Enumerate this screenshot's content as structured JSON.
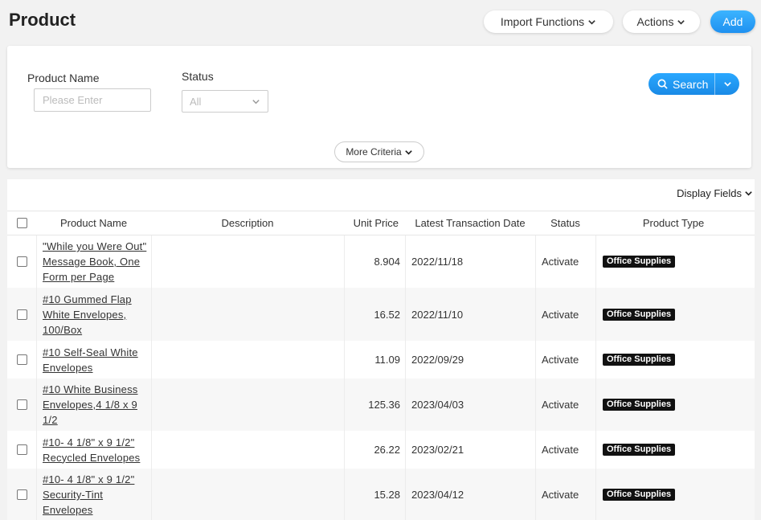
{
  "header": {
    "title": "Product",
    "import_label": "Import Functions",
    "actions_label": "Actions",
    "add_label": "Add"
  },
  "filters": {
    "product_name_label": "Product Name",
    "product_name_placeholder": "Please Enter",
    "status_label": "Status",
    "status_value": "All",
    "search_label": "Search",
    "more_criteria_label": "More Criteria"
  },
  "table": {
    "display_fields_label": "Display Fields",
    "columns": {
      "product_name": "Product Name",
      "description": "Description",
      "unit_price": "Unit Price",
      "latest_transaction_date": "Latest Transaction Date",
      "status": "Status",
      "product_type": "Product Type"
    },
    "rows": [
      {
        "name_lines": [
          "\"While you Were Out\"",
          "Message Book, One",
          "Form per Page"
        ],
        "description": "",
        "unit_price": "8.904",
        "date": "2022/11/18",
        "status": "Activate",
        "type": "Office Supplies"
      },
      {
        "name_lines": [
          "#10 Gummed Flap",
          "White Envelopes,",
          "100/Box"
        ],
        "description": "",
        "unit_price": "16.52",
        "date": "2022/11/10",
        "status": "Activate",
        "type": "Office Supplies"
      },
      {
        "name_lines": [
          "#10 Self-Seal White",
          "Envelopes"
        ],
        "description": "",
        "unit_price": "11.09",
        "date": "2022/09/29",
        "status": "Activate",
        "type": "Office Supplies"
      },
      {
        "name_lines": [
          "#10 White Business",
          "Envelopes,4 1/8 x 9",
          "1/2"
        ],
        "description": "",
        "unit_price": "125.36",
        "date": "2023/04/03",
        "status": "Activate",
        "type": "Office Supplies"
      },
      {
        "name_lines": [
          "#10- 4 1/8\" x 9 1/2\"",
          "Recycled Envelopes"
        ],
        "description": "",
        "unit_price": "26.22",
        "date": "2023/02/21",
        "status": "Activate",
        "type": "Office Supplies"
      },
      {
        "name_lines": [
          "#10- 4 1/8\" x 9 1/2\"",
          "Security-Tint",
          "Envelopes"
        ],
        "description": "",
        "unit_price": "15.28",
        "date": "2023/04/12",
        "status": "Activate",
        "type": "Office Supplies"
      }
    ]
  },
  "colors": {
    "accent": "#1e90f0",
    "badge_bg": "#111111",
    "page_bg": "#f2f2f2"
  },
  "icons": [
    "chevron-down-icon",
    "search-icon"
  ]
}
